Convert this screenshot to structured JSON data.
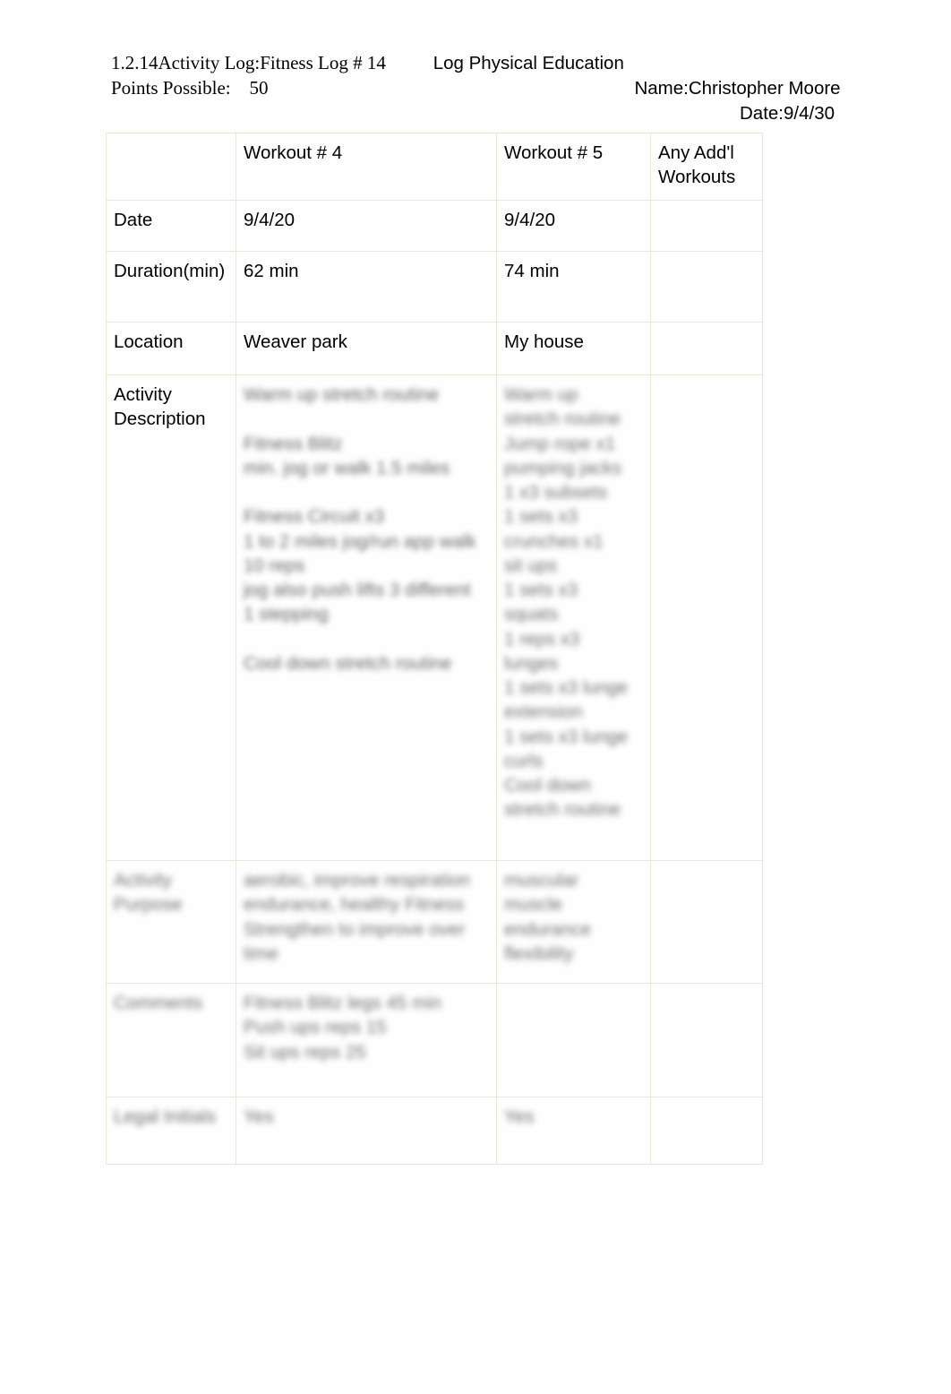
{
  "header": {
    "assignment_code": "1.2.14Activity Log:Fitness Log # 14",
    "course": "Log Physical Education",
    "points_label": "Points Possible:",
    "points_value": "50",
    "name": "Name:Christopher Moore",
    "date": "Date:9/4/30"
  },
  "table": {
    "columns": [
      "",
      "Workout # 4",
      "Workout # 5",
      "Any Add'l Workouts"
    ],
    "rows": [
      {
        "label": "Date",
        "blurred_label": false,
        "w4": [
          "9/4/20"
        ],
        "w5": [
          "9/4/20"
        ],
        "extra": [],
        "blurred_cells": false
      },
      {
        "label": "Duration(min)",
        "blurred_label": false,
        "w4": [
          "62 min"
        ],
        "w5": [
          "74 min"
        ],
        "extra": [],
        "blurred_cells": false
      },
      {
        "label": "Location",
        "blurred_label": false,
        "w4": [
          "Weaver park"
        ],
        "w5": [
          "My house"
        ],
        "extra": [],
        "blurred_cells": false
      },
      {
        "label": "Activity Description",
        "blurred_label": false,
        "w4": [
          "Warm up stretch routine",
          "",
          "Fitness Blitz",
          "min. jog or walk 1.5 miles",
          "",
          "Fitness Circuit x3",
          "1 to 2 miles jog/run app walk",
          "10 reps",
          "jog also push lifts 3 different",
          "1 stepping",
          "",
          "Cool down stretch routine"
        ],
        "w5": [
          "Warm up",
          "stretch routine",
          "Jump rope x1",
          "pumping jacks",
          "1 x3 subsets",
          "1 sets x3",
          "crunches x1",
          "sit ups",
          "1 sets x3",
          "squats",
          "1 reps x3",
          "lunges",
          "1 sets x3 lunge",
          "extension",
          "1 sets x3 lunge",
          "curls",
          "Cool down",
          "stretch routine"
        ],
        "extra": [],
        "blurred_cells": true
      },
      {
        "label": "Activity Purpose",
        "blurred_label": true,
        "w4": [
          "aerobic, improve respiration",
          "endurance, healthy Fitness",
          "Strengthen to improve over",
          "time"
        ],
        "w5": [
          "muscular",
          "muscle",
          "endurance",
          "flexibility"
        ],
        "extra": [],
        "blurred_cells": true
      },
      {
        "label": "Comments",
        "blurred_label": true,
        "w4": [
          "Fitness Blitz legs 45 min",
          "Push ups reps 15",
          "Sit ups reps 25"
        ],
        "w5": [],
        "extra": [],
        "blurred_cells": true
      },
      {
        "label": "Legal Initials",
        "blurred_label": true,
        "w4": [
          "Yes"
        ],
        "w5": [
          "Yes"
        ],
        "extra": [],
        "blurred_cells": true
      }
    ]
  },
  "colors": {
    "page_background": "#ffffff",
    "text": "#000000",
    "table_border": "#e6e6d9",
    "cell_background": "#fefefe",
    "redacted_text": "#3a3a3a"
  }
}
